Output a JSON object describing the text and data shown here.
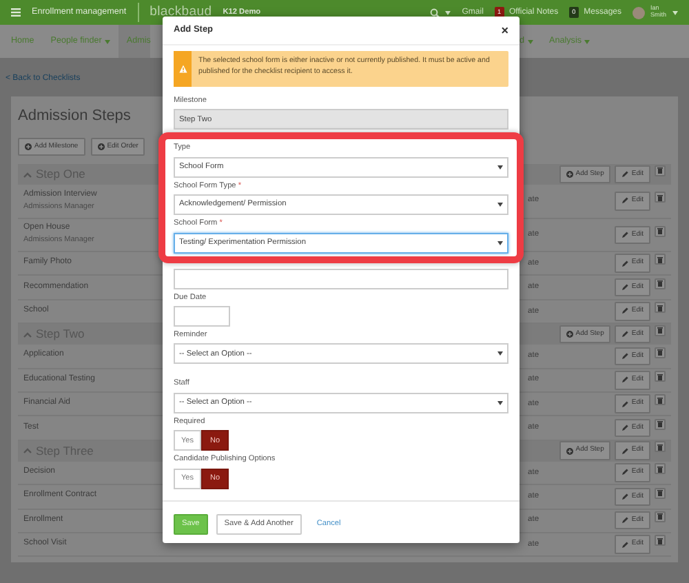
{
  "top_bar": {
    "app_name": "Enrollment management",
    "logo": "blackbaud",
    "school": "K12 Demo",
    "link": "Gmail",
    "notifications": [
      {
        "count": "1",
        "label": "Official Notes",
        "color": "#8e1b12"
      },
      {
        "count": "0",
        "label": "Messages",
        "color": "#233a18"
      }
    ],
    "user": "Ian Smith"
  },
  "nav": [
    {
      "label": "Home",
      "dropdown": false,
      "selected": false
    },
    {
      "label": "People finder",
      "dropdown": true,
      "selected": false
    },
    {
      "label": "Admis",
      "dropdown": false,
      "selected": true
    },
    {
      "label": "d",
      "dropdown": true,
      "selected": false
    },
    {
      "label": "Analysis",
      "dropdown": true,
      "selected": false
    }
  ],
  "back_link": "< Back to Checklists",
  "panel": {
    "title": "Admission Steps",
    "buttons": [
      "Add Milestone",
      "Edit Order"
    ],
    "milestones": [
      {
        "name": "Step One",
        "expanded": true,
        "add_step": "Add Step",
        "edit": "Edit",
        "steps": [
          {
            "name": "Admission Interview",
            "assignee": "Admissions Manager",
            "column_2": "ate",
            "edit": "Edit"
          },
          {
            "name": "Open House",
            "assignee": "Admissions Manager",
            "column_2": "ate",
            "edit": "Edit"
          },
          {
            "name": "Family Photo",
            "column_2": "ate",
            "edit": "Edit"
          },
          {
            "name": "Recommendation",
            "column_2": "ate",
            "edit": "Edit"
          },
          {
            "name": "School",
            "column_2": "ate",
            "edit": "Edit"
          }
        ]
      },
      {
        "name": "Step Two",
        "expanded": true,
        "add_step": "Add Step",
        "edit": "Edit",
        "steps": [
          {
            "name": "Application",
            "column_2": "ate",
            "edit": "Edit"
          },
          {
            "name": "Educational Testing",
            "column_2": "ate",
            "edit": "Edit"
          },
          {
            "name": "Financial Aid",
            "column_2": "ate",
            "edit": "Edit"
          },
          {
            "name": "Test",
            "column_2": "ate",
            "edit": "Edit"
          }
        ]
      },
      {
        "name": "Step Three",
        "expanded": true,
        "add_step": "Add Step",
        "edit": "Edit",
        "steps": [
          {
            "name": "Decision",
            "column_2": "ate",
            "edit": "Edit"
          },
          {
            "name": "Enrollment Contract",
            "column_2": "ate",
            "edit": "Edit"
          },
          {
            "name": "Enrollment",
            "column_2": "ate",
            "edit": "Edit"
          },
          {
            "name": "School Visit",
            "column_2": "ate",
            "edit": "Edit"
          }
        ]
      }
    ]
  },
  "modal": {
    "title": "Add Step",
    "close": "×",
    "alert": "The selected school form is either inactive or not currently published. It must be active and published for the checklist recipient to access it.",
    "fields": [
      {
        "kind": "select",
        "label": "Milestone",
        "value": "Step Two",
        "disabled": true,
        "focused": false
      },
      {
        "kind": "group",
        "framed": true,
        "fields": [
          {
            "kind": "select",
            "label": "Type",
            "value": "School Form",
            "disabled": false,
            "focused": false
          },
          {
            "kind": "select",
            "label": "School Form Type",
            "required_mark": "*",
            "value": "Acknowledgement/ Permission",
            "disabled": false,
            "focused": false
          },
          {
            "kind": "select",
            "label": "School Form",
            "required_mark": "*",
            "value": "Testing/ Experimentation Permission",
            "disabled": false,
            "focused": true
          }
        ]
      },
      {
        "kind": "text",
        "disabled": false,
        "focused": false
      },
      {
        "kind": "date",
        "label": "Due Date",
        "disabled": false,
        "focused": false
      },
      {
        "kind": "select",
        "label": "Reminder",
        "value": "-- Select an Option --",
        "disabled": false,
        "focused": false
      },
      {
        "kind": "select",
        "label": "Staff",
        "value": "-- Select an Option --",
        "disabled": false,
        "focused": false
      },
      {
        "kind": "toggle",
        "label": "Required",
        "options": [
          {
            "label": "Yes",
            "selected": false
          },
          {
            "label": "No",
            "selected": true
          }
        ]
      },
      {
        "kind": "toggle",
        "label": "Candidate Publishing Options",
        "options": [
          {
            "label": "Yes",
            "selected": false
          },
          {
            "label": "No",
            "selected": true
          }
        ]
      }
    ],
    "buttons": [
      {
        "label": "Save",
        "kind": "primary"
      },
      {
        "label": "Save & Add Another",
        "kind": "default"
      },
      {
        "label": "Cancel",
        "kind": "link"
      }
    ]
  }
}
